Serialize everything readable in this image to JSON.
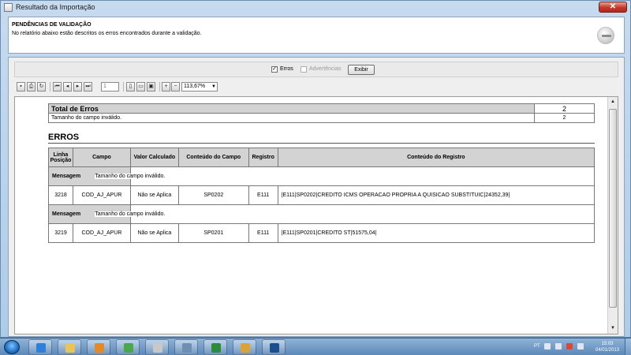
{
  "window": {
    "title": "Resultado da Importação",
    "close_label": "✕"
  },
  "header": {
    "title": "PENDÊNCIAS DE VALIDAÇÃO",
    "description": "No relatório abaixo estão descritos os erros encontrados durante a validação."
  },
  "filters": {
    "erros_label": "Erros",
    "erros_checked": true,
    "advertencias_label": "Advertências",
    "advertencias_checked": false,
    "exibir_label": "Exibir"
  },
  "toolbar": {
    "page_value": "1",
    "zoom_value": "113,67%"
  },
  "report": {
    "total_label": "Total de Erros",
    "total_value": "2",
    "rows": [
      {
        "label": "Tamanho do campo inválido.",
        "value": "2"
      }
    ],
    "erros_title": "ERROS",
    "columns": [
      "Linha Posição",
      "Campo",
      "Valor Calculado",
      "Conteúdo do Campo",
      "Registro",
      "Conteúdo do Registro"
    ],
    "errors": [
      {
        "mensagem_label": "Mensagem",
        "mensagem": "Tamanho do campo inválido.",
        "linha": "3218",
        "campo": "COD_AJ_APUR",
        "valor_calculado": "Não se Aplica",
        "conteudo_campo": "SP0202",
        "registro": "E111",
        "conteudo_registro": "|E111|SP0202|CREDITO ICMS OPERACAO PROPRIA A QUISICAO SUBSTITUIC|24352,39|"
      },
      {
        "mensagem_label": "Mensagem",
        "mensagem": "Tamanho do campo inválido.",
        "linha": "3219",
        "campo": "COD_AJ_APUR",
        "valor_calculado": "Não se Aplica",
        "conteudo_campo": "SP0201",
        "registro": "E111",
        "conteudo_registro": "|E111|SP0201|CREDITO ST|51575,04|"
      }
    ]
  },
  "taskbar": {
    "language": "PT",
    "time": "15:03",
    "date": "04/01/2013"
  }
}
